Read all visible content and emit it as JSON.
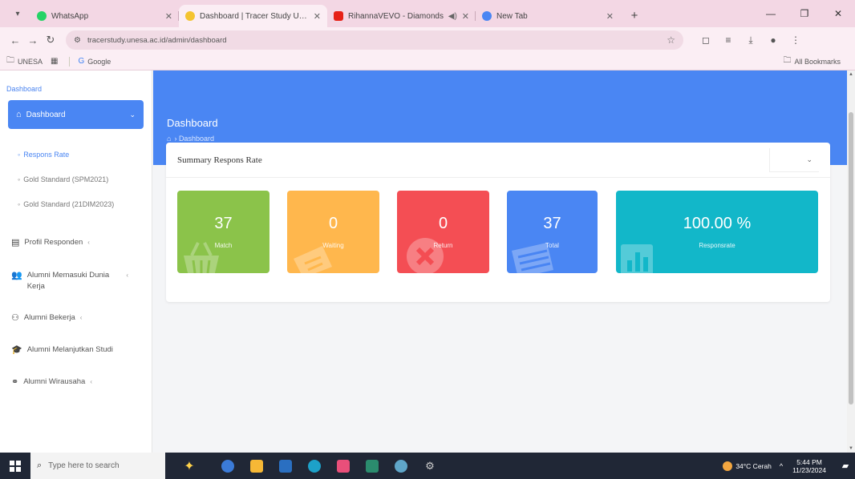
{
  "browser": {
    "tabs": [
      {
        "title": "WhatsApp",
        "favicon_color": "#25d366",
        "active": false
      },
      {
        "title": "Dashboard | Tracer Study Unesa",
        "favicon_color": "#f4c430",
        "active": true
      },
      {
        "title": "RihannaVEVO - Diamonds",
        "favicon_color": "#e62117",
        "active": false
      },
      {
        "title": "New Tab",
        "favicon_color": "#4a86f3",
        "active": false
      }
    ],
    "url": "tracerstudy.unesa.ac.id/admin/dashboard",
    "bookmarks": [
      {
        "label": "UNESA",
        "icon": "folder-icon"
      },
      {
        "label": "",
        "icon": "apps-grid-icon"
      },
      {
        "label": "Google",
        "icon": "google-icon"
      }
    ],
    "all_bookmarks": "All Bookmarks"
  },
  "sidebar": {
    "header": "Dashboard",
    "active_item": "Dashboard",
    "subitems": [
      "Respons Rate",
      "Gold Standard (SPM2021)",
      "Gold Standard (21DIM2023)"
    ],
    "menu": [
      {
        "label": "Profil Responden",
        "icon": "id-card-icon"
      },
      {
        "label": "Alumni Memasuki Dunia Kerja",
        "icon": "users-icon"
      },
      {
        "label": "Alumni Bekerja",
        "icon": "binoculars-icon"
      },
      {
        "label": "Alumni Melanjutkan Studi",
        "icon": "graduation-cap-icon"
      },
      {
        "label": "Alumni Wirausaha",
        "icon": "handshake-icon"
      }
    ]
  },
  "header": {
    "title": "Dashboard",
    "breadcrumb": "Dashboard"
  },
  "summary": {
    "title": "Summary Respons Rate",
    "stats": [
      {
        "value": "37",
        "label": "Match",
        "color": "#8bc34a",
        "icon": "basket-icon"
      },
      {
        "value": "0",
        "label": "Waiting",
        "color": "#ffb74d",
        "icon": "ticket-icon"
      },
      {
        "value": "0",
        "label": "Return",
        "color": "#f44e54",
        "icon": "x-circle-icon"
      },
      {
        "value": "37",
        "label": "Total",
        "color": "#4a86f3",
        "icon": "table-icon"
      },
      {
        "value": "100.00 %",
        "label": "Responsrate",
        "color": "#12b7c9",
        "icon": "bar-chart-icon"
      }
    ]
  },
  "taskbar": {
    "search_placeholder": "Type here to search",
    "weather": "34°C Cerah",
    "time": "5:44 PM",
    "date": "11/23/2024",
    "app_colors": [
      "#3b7bd8",
      "#f6b836",
      "#2a6fc1",
      "#1da1c9",
      "#e94f7a",
      "#2b8c6e",
      "#5fa6c9",
      "#cccccc"
    ]
  }
}
